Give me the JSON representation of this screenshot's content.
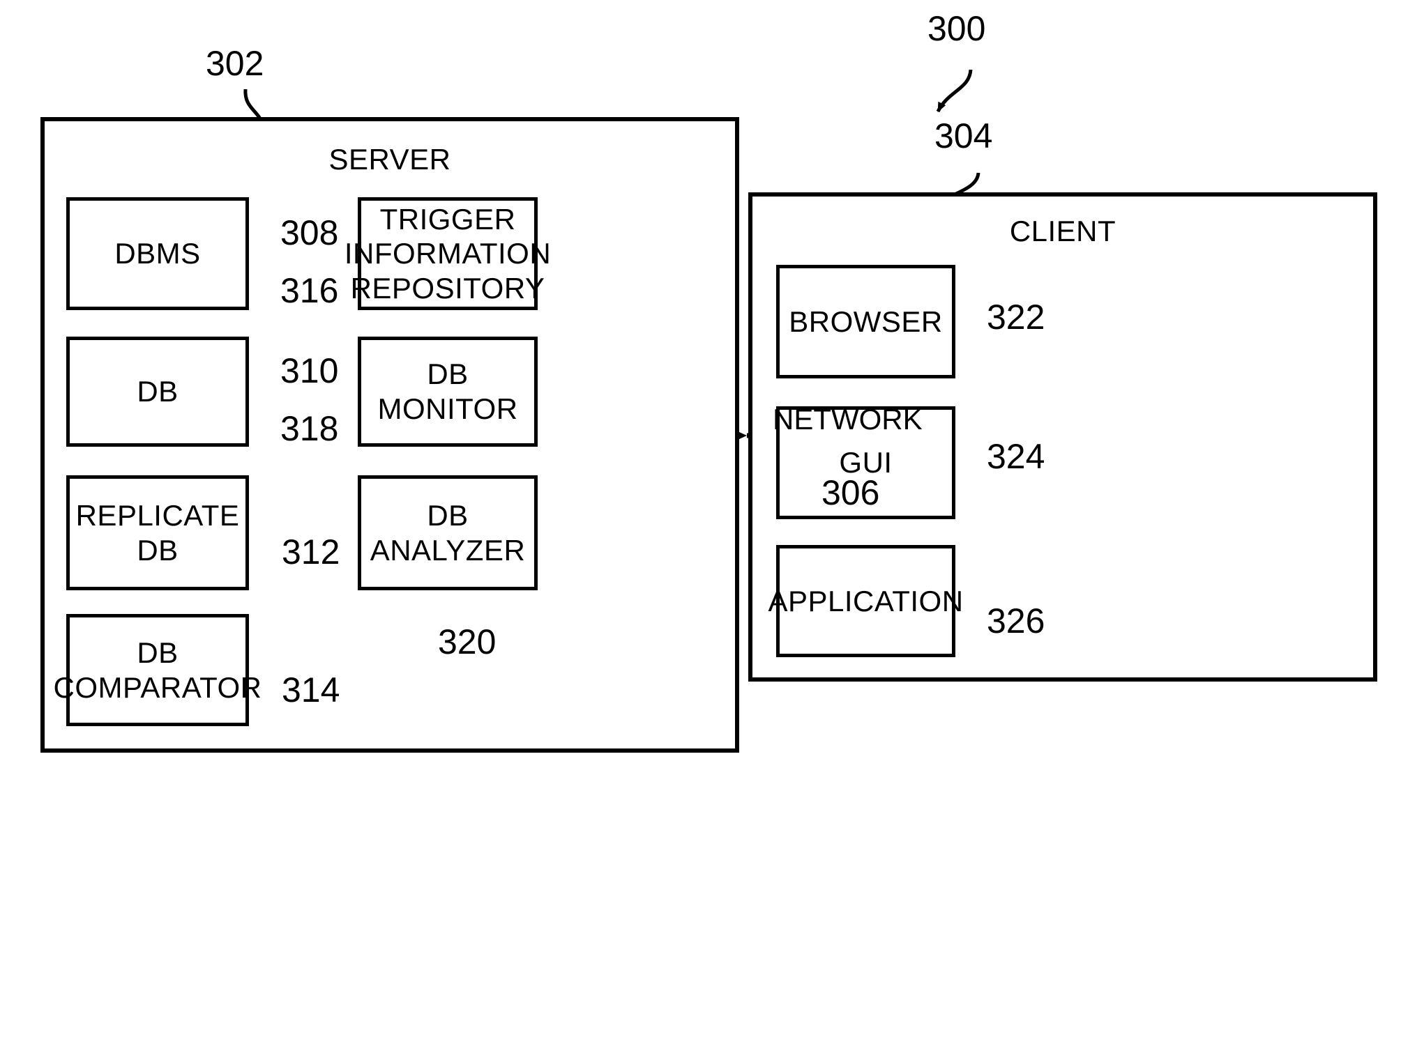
{
  "figure": {
    "overall_ref": "300",
    "server_title": "SERVER",
    "client_title": "CLIENT",
    "network_label": "NETWORK",
    "network_ref": "306",
    "server_ref": "302",
    "client_ref": "304"
  },
  "server": {
    "title": "SERVER",
    "ref": "302",
    "left_column": [
      {
        "label": "DBMS",
        "ref": "308"
      },
      {
        "label": "DB",
        "ref": "310"
      },
      {
        "label": "REPLICATE\nDB",
        "ref": "312"
      },
      {
        "label": "DB\nCOMPARATOR",
        "ref": "314"
      }
    ],
    "right_column": [
      {
        "label": "TRIGGER\nINFORMATION\nREPOSITORY",
        "ref": "316"
      },
      {
        "label": "DB\nMONITOR",
        "ref": "318"
      },
      {
        "label": "DB\nANALYZER",
        "ref": "320"
      }
    ]
  },
  "client": {
    "title": "CLIENT",
    "ref": "304",
    "components": [
      {
        "label": "BROWSER",
        "ref": "322"
      },
      {
        "label": "GUI",
        "ref": "324"
      },
      {
        "label": "APPLICATION",
        "ref": "326"
      }
    ]
  },
  "colors": {
    "line": "#000000",
    "background": "#ffffff"
  }
}
